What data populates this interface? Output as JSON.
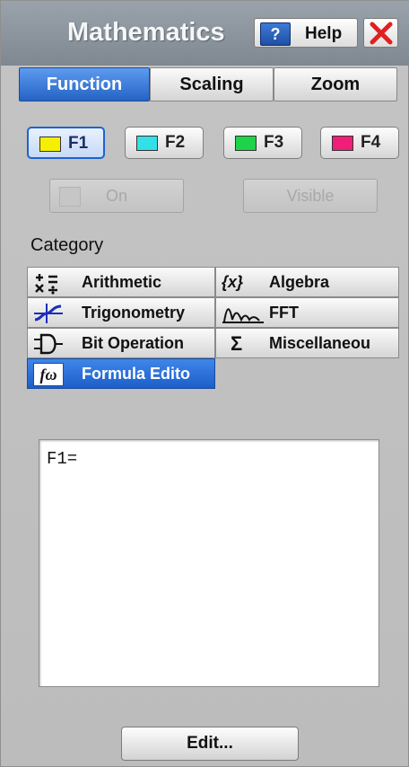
{
  "window": {
    "title": "Mathematics",
    "help_label": "Help",
    "help_icon_text": "?"
  },
  "tabs": [
    {
      "label": "Function",
      "active": true
    },
    {
      "label": "Scaling",
      "active": false
    },
    {
      "label": "Zoom",
      "active": false
    }
  ],
  "functions": [
    {
      "label": "F1",
      "color": "#f5f000",
      "selected": true
    },
    {
      "label": "F2",
      "color": "#33e0e8",
      "selected": false
    },
    {
      "label": "F3",
      "color": "#1ed24a",
      "selected": false
    },
    {
      "label": "F4",
      "color": "#f01e78",
      "selected": false
    }
  ],
  "toggles": {
    "on_label": "On",
    "visible_label": "Visible"
  },
  "category": {
    "label": "Category",
    "items": [
      {
        "label": "Arithmetic",
        "icon": "arithmetic-icon",
        "selected": false
      },
      {
        "label": "Algebra",
        "icon": "algebra-icon",
        "icon_text": "{x}",
        "selected": false
      },
      {
        "label": "Trigonometry",
        "icon": "sine-wave-icon",
        "selected": false
      },
      {
        "label": "FFT",
        "icon": "fft-spectrum-icon",
        "selected": false
      },
      {
        "label": "Bit Operation",
        "icon": "logic-gate-icon",
        "selected": false
      },
      {
        "label": "Miscellaneou",
        "icon": "sigma-icon",
        "icon_text": "Σ",
        "selected": false
      },
      {
        "label": "Formula Edito",
        "icon": "function-icon",
        "icon_text": "fω",
        "selected": true
      }
    ]
  },
  "formula": {
    "text": "F1="
  },
  "edit_button": {
    "label": "Edit..."
  },
  "colors": {
    "accent": "#2463c4",
    "close_x": "#e02020"
  }
}
